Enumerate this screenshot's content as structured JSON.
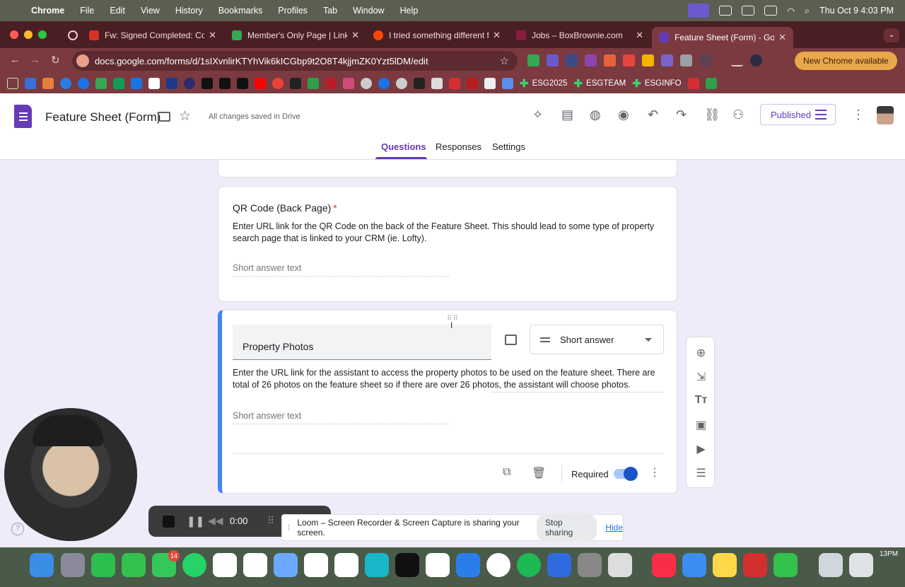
{
  "menubar": {
    "app": "Chrome",
    "items": [
      "File",
      "Edit",
      "View",
      "History",
      "Bookmarks",
      "Profiles",
      "Tab",
      "Window",
      "Help"
    ],
    "clock": "Thu Oct 9  4:03 PM"
  },
  "browser": {
    "tabs": [
      {
        "title": "Fw: Signed Completed: Comp",
        "favicon_color": "#d93025"
      },
      {
        "title": "Member's Only Page | Linktre",
        "favicon_color": "#34a853"
      },
      {
        "title": "I tried something different for",
        "favicon_color": "#ff4500"
      },
      {
        "title": "Jobs – BoxBrownie.com",
        "favicon_color": "#8b1e3f"
      },
      {
        "title": "Feature Sheet (Form) - Go",
        "favicon_color": "#673ab7"
      }
    ],
    "url": "docs.google.com/forms/d/1sIXvnlirKTYhVik6kICGbp9t2O8T4kjjmZK0Yzt5lDM/edit",
    "update_label": "New Chrome available",
    "bookmark_labels": [
      "ESG2025",
      "ESGTEAM",
      "ESGINFO"
    ]
  },
  "form": {
    "title": "Feature Sheet (Form)",
    "save_status": "All changes saved in Drive",
    "published_label": "Published",
    "tabs": [
      "Questions",
      "Responses",
      "Settings"
    ],
    "questions": [
      {
        "title": "QR Code (Back Page)",
        "required_mark": "*",
        "description": "Enter URL link for the QR Code on the back of the Feature Sheet. This should lead to some type of property search page that is linked to your CRM (ie. Lofty).",
        "answer_placeholder": "Short answer text"
      },
      {
        "title": "Property Photos",
        "type": "Short answer",
        "description": "Enter the URL link for the assistant to access the property photos to be used on the feature sheet. There are total of 26 photos on the feature sheet so if there are over 26 photos, the assistant will choose photos.",
        "answer_placeholder": "Short answer text",
        "required_label": "Required",
        "required": true
      }
    ],
    "accent_color": "#673ab7",
    "active_card_color": "#4285f4"
  },
  "loom": {
    "timer": "0:00",
    "share_message": "Loom – Screen Recorder & Screen Capture is sharing your screen.",
    "stop_label": "Stop sharing",
    "hide_label": "Hide"
  },
  "dock": {
    "messages_badge": "14",
    "clock_fragment": "13PM"
  }
}
